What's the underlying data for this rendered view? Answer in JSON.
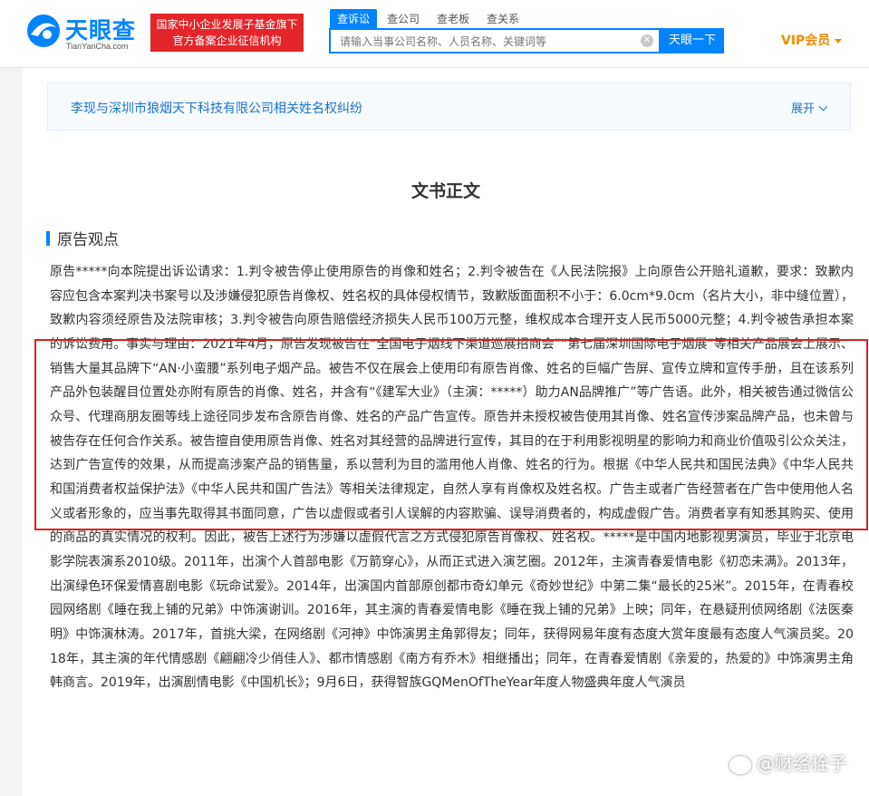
{
  "header": {
    "logo_cn": "天眼查",
    "logo_en": "TianYanCha.com",
    "badge_line1": "国家中小企业发展子基金旗下",
    "badge_line2": "官方备案企业征信机构",
    "search_tabs": [
      "查诉讼",
      "查公司",
      "查老板",
      "查关系"
    ],
    "search_placeholder": "请输入当事公司名称、人员名称、关键词等",
    "search_button": "天眼一下",
    "vip_label": "VIP会员"
  },
  "related": {
    "title": "李现与深圳市狼烟天下科技有限公司相关姓名权纠纷",
    "expand_label": "展开"
  },
  "document": {
    "title": "文书正文",
    "section_title": "原告观点",
    "body": "原告*****向本院提出诉讼请求：1.判令被告停止使用原告的肖像和姓名；2.判令被告在《人民法院报》上向原告公开赔礼道歉，要求：致歉内容应包含本案判决书案号以及涉嫌侵犯原告肖像权、姓名权的具体侵权情节，致歉版面面积不小于：6.0cm*9.0cm（名片大小，非中缝位置），致歉内容须经原告及法院审核；3.判令被告向原告赔偿经济损失人民币100万元整，维权成本合理开支人民币5000元整；4.判令被告承担本案的诉讼费用。事实与理由：2021年4月，原告发现被告在“全国电子烟线下渠道巡展招商会”“第七届深圳国际电子烟展”等相关产品展会上展示、销售大量其品牌下“AN·小蛮腰”系列电子烟产品。被告不仅在展会上使用印有原告肖像、姓名的巨幅广告屏、宣传立牌和宣传手册，且在该系列产品外包装醒目位置处亦附有原告的肖像、姓名，并含有“《建军大业》（主演：*****）助力AN品牌推广”等广告语。此外，相关被告通过微信公众号、代理商朋友圈等线上途径同步发布含原告肖像、姓名的产品广告宣传。原告并未授权被告使用其肖像、姓名宣传涉案品牌产品，也未曾与被告存在任何合作关系。被告擅自使用原告肖像、姓名对其经营的品牌进行宣传，其目的在于利用影视明星的影响力和商业价值吸引公众关注，达到广告宣传的效果，从而提高涉案产品的销售量，系以营利为目的滥用他人肖像、姓名的行为。根据《中华人民共和国民法典》《中华人民共和国消费者权益保护法》《中华人民共和国广告法》等相关法律规定，自然人享有肖像权及姓名权。广告主或者广告经营者在广告中使用他人名义或者形象的，应当事先取得其书面同意，广告以虚假或者引人误解的内容欺骗、误导消费者的，构成虚假广告。消费者享有知悉其购买、使用的商品的真实情况的权利。因此，被告上述行为涉嫌以虚假代言之方式侵犯原告肖像权、姓名权。*****是中国内地影视男演员，毕业于北京电影学院表演系2010级。2011年，出演个人首部电影《万箭穿心》，从而正式进入演艺圈。2012年，主演青春爱情电影《初恋未满》。2013年，出演绿色环保爱情喜剧电影《玩命试爱》。2014年，出演国内首部原创都市奇幻单元《奇妙世纪》中第二集“最长的25米”。2015年，在青春校园网络剧《睡在我上铺的兄弟》中饰演谢训。2016年，其主演的青春爱情电影《睡在我上铺的兄弟》上映；同年，在悬疑刑侦网络剧《法医秦明》中饰演林涛。2017年，首挑大梁，在网络剧《河神》中饰演男主角郭得友；同年，获得网易年度有态度大赏年度最有态度人气演员奖。2018年，其主演的年代情感剧《翩翩冷少俏佳人》、都市情感剧《南方有乔木》相继播出；同年，在青春爱情剧《亲爱的，热爱的》中饰演男主角韩商言。2019年，出演剧情电影《中国机长》；9月6日，获得智族GQMenOfTheYear年度人物盛典年度人气演员"
  },
  "watermark": "@财经栓子"
}
